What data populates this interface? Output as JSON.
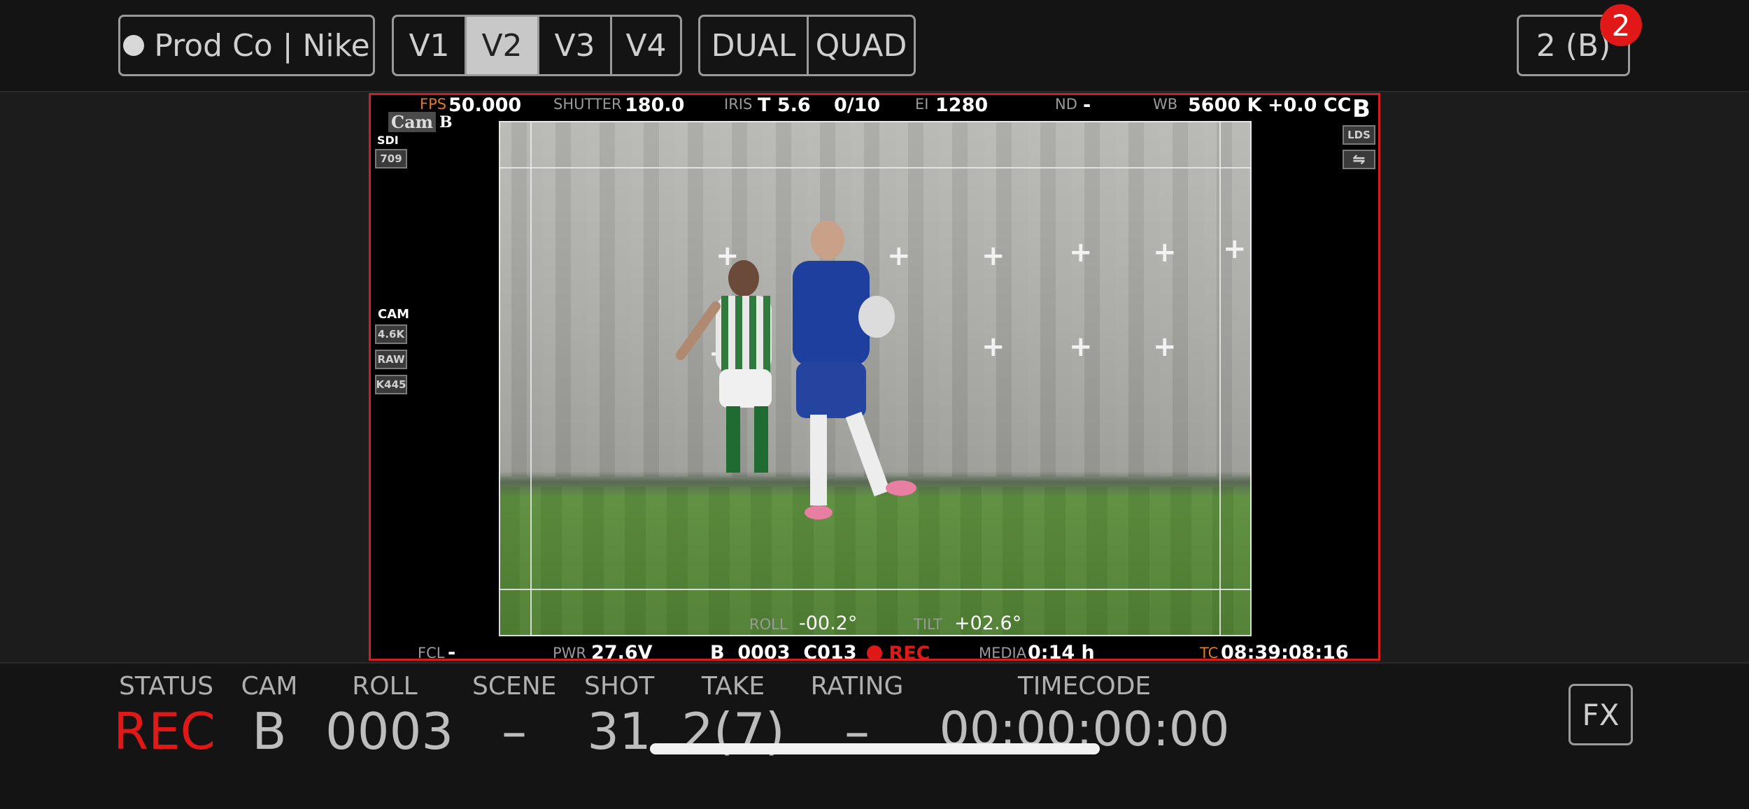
{
  "topbar": {
    "project": "Prod Co | Nike",
    "views": [
      "V1",
      "V2",
      "V3",
      "V4"
    ],
    "active_view": "V2",
    "layouts": [
      "DUAL",
      "QUAD"
    ],
    "camera_select": "2 (B)",
    "notification_count": "2"
  },
  "monitor": {
    "fps_label": "FPS",
    "fps": "50.000",
    "shutter_label": "SHUTTER",
    "shutter": "180.0",
    "iris_label": "IRIS",
    "iris": "T 5.6",
    "iris_frac": "0/10",
    "ei_label": "EI",
    "ei": "1280",
    "nd_label": "ND",
    "nd": "-",
    "wb_label": "WB",
    "wb": "5600 K",
    "cc": "+0.0 CC",
    "cam_letter": "B",
    "cam_name": "Cam",
    "cam_name_letter": "B",
    "sdi_label": "SDI",
    "sdi_value": "709",
    "cam_label": "CAM",
    "cam_tags": [
      "4.6K",
      "RAW",
      "K445"
    ],
    "lds_label": "LDS",
    "roll_label": "ROLL",
    "roll": "-00.2°",
    "tilt_label": "TILT",
    "tilt": "+02.6°",
    "fcl_label": "FCL",
    "fcl": "-",
    "pwr_label": "PWR",
    "pwr": "27.6V",
    "clip": "B  0003  C013",
    "rec": "REC",
    "media_label": "MEDIA",
    "media": "0:14 h",
    "tc_label": "TC",
    "tc": "08:39:08:16"
  },
  "slate": {
    "status_label": "STATUS",
    "status": "REC",
    "cam_label": "CAM",
    "cam": "B",
    "roll_label": "ROLL",
    "roll": "0003",
    "scene_label": "SCENE",
    "scene": "–",
    "shot_label": "SHOT",
    "shot": "31",
    "take_label": "TAKE",
    "take": "2(7)",
    "rating_label": "RATING",
    "rating": "–",
    "timecode_label": "TIMECODE",
    "timecode": "00:00:00:00",
    "fx_button": "FX"
  },
  "colors": {
    "rec": "#e11818",
    "accent_orange": "#e07a2a",
    "frame_border": "#d11f1f"
  }
}
